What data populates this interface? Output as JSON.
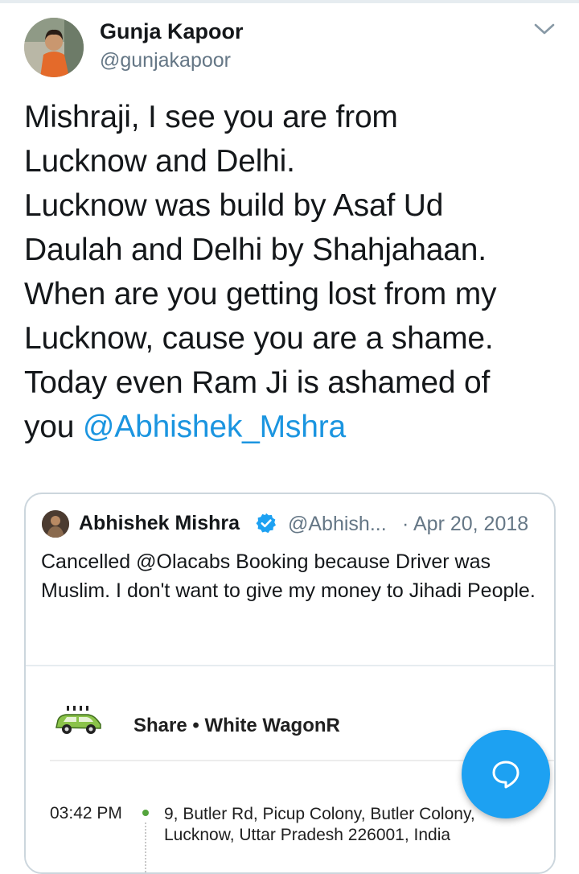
{
  "tweet": {
    "author_name": "Gunja Kapoor",
    "author_handle": "@gunjakapoor",
    "text": "Mishraji, I see you are from\nLucknow and Delhi.\nLucknow was build by Asaf Ud\nDaulah and Delhi by Shahjahaan.\nWhen are you getting lost from my\nLucknow, cause you are a shame.\nToday even Ram Ji is ashamed of\nyou ",
    "mention": "@Abhishek_Mshra",
    "menu_icon": "chevron-down-icon"
  },
  "quoted_tweet": {
    "author_name": "Abhishek Mishra",
    "verified": true,
    "handle": "@Abhish...",
    "separator": "·",
    "date": "Apr 20, 2018",
    "text": "Cancelled @Olacabs Booking because Driver was Muslim. I don't want to give my money to Jihadi People."
  },
  "ride_card": {
    "ride_type": "Share • White WagonR",
    "time": "03:42 PM",
    "pickup_address": "9, Butler Rd, Picup Colony, Butler Colony, Lucknow, Uttar Pradesh 226001, India",
    "car_icon": "car-icon"
  },
  "fab": {
    "icon": "compose-reply-icon",
    "color": "#1da1f2"
  },
  "colors": {
    "link": "#1b95e0",
    "secondary_text": "#657786",
    "verified_badge": "#1da1f2",
    "route_dot": "#54a43c",
    "car_body": "#8bc34a"
  }
}
